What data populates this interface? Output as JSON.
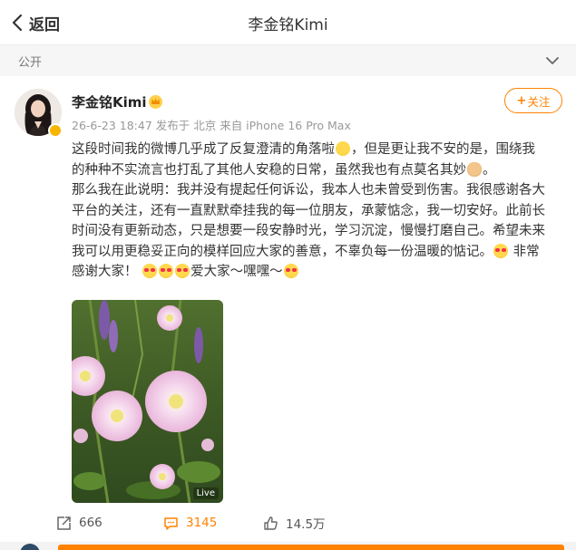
{
  "header": {
    "back_label": "返回",
    "title": "李金铭Kimi"
  },
  "visibility": {
    "label": "公开"
  },
  "post": {
    "author": "李金铭Kimi",
    "meta": "26-6-23 18:47 发布于 北京 来自 iPhone 16 Pro Max",
    "follow_label": "关注",
    "lines": [
      "这段时间我的微博几乎成了反复澄清的角落啦",
      "，但是更让我不安的是，围绕我",
      "的种种不实流言也打乱了其他人安稳的日常，虽然我也有点莫名其妙",
      "。",
      "那么我在此说明：我并没有提起任何诉讼，我本人也未曾受到伤害。我很感谢各大",
      "平台的关注，还有一直默默牵挂我的每一位朋友，承蒙惦念，我一切安好。此前长",
      "时间没有更新动态，只是想要一段安静时光，学习沉淀，慢慢打磨自己。希望未来",
      "我可以用更稳妥正向的模样回应大家的善意，不辜负每一份温暖的惦记。",
      " 非常",
      "感谢大家！",
      "爱大家～嘿嘿～"
    ],
    "photo_badge": "Live"
  },
  "actions": {
    "reposts": "666",
    "comments": "3145",
    "likes": "14.5万"
  },
  "colors": {
    "accent": "#ff8200",
    "verified": "#f7b500"
  },
  "icons": [
    "back-chevron-icon",
    "chevron-down-icon",
    "crown-icon",
    "verified-badge-icon",
    "repost-icon",
    "comment-icon",
    "like-icon"
  ]
}
